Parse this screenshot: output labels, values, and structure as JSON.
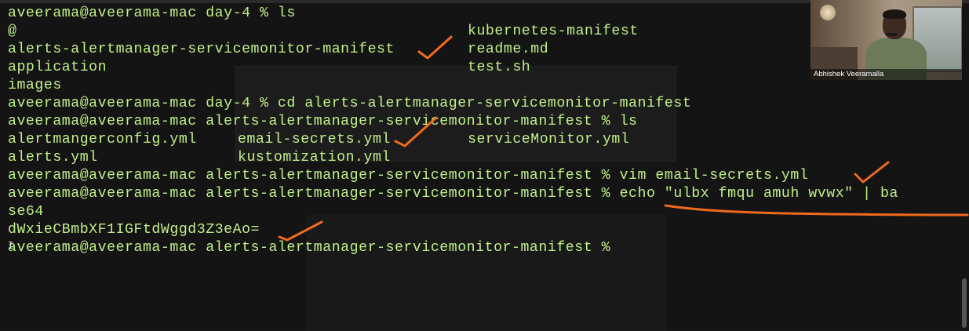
{
  "terminal": {
    "prompt_dir": "day-4",
    "lines": [
      {
        "left": "aveerama@aveerama-mac day-4 % ls"
      },
      {
        "left": "@",
        "right": "kubernetes-manifest"
      },
      {
        "left": "alerts-alertmanager-servicemonitor-manifest",
        "right": "readme.md"
      },
      {
        "left": "application",
        "right": "test.sh"
      },
      {
        "left": "images"
      },
      {
        "left": "aveerama@aveerama-mac day-4 % cd alerts-alertmanager-servicemonitor-manifest"
      },
      {
        "left": "aveerama@aveerama-mac alerts-alertmanager-servicemonitor-manifest % ls"
      },
      {
        "left": "alertmangerconfig.yml",
        "mid": "email-secrets.yml",
        "right": "serviceMonitor.yml"
      },
      {
        "left": "alerts.yml",
        "mid": "kustomization.yml"
      },
      {
        "left": "aveerama@aveerama-mac alerts-alertmanager-servicemonitor-manifest % vim email-secrets.yml"
      },
      {
        "left": "aveerama@aveerama-mac alerts-alertmanager-servicemonitor-manifest % echo \"ulbx fmqu amuh wvwx\" | ba"
      },
      {
        "left": "se64"
      },
      {
        "left": "dWxieCBmbXF1IGFtdWggd3Z3eAo="
      },
      {
        "left": "aveerama@aveerama-mac alerts-alertmanager-servicemonitor-manifest %"
      }
    ]
  },
  "webcam": {
    "name": "Abhishek Veeramalla"
  },
  "annotations": {
    "color": "#f06a1e",
    "icons": [
      "checkmark-annotation",
      "underline-annotation"
    ]
  },
  "cursor": "I-beam"
}
